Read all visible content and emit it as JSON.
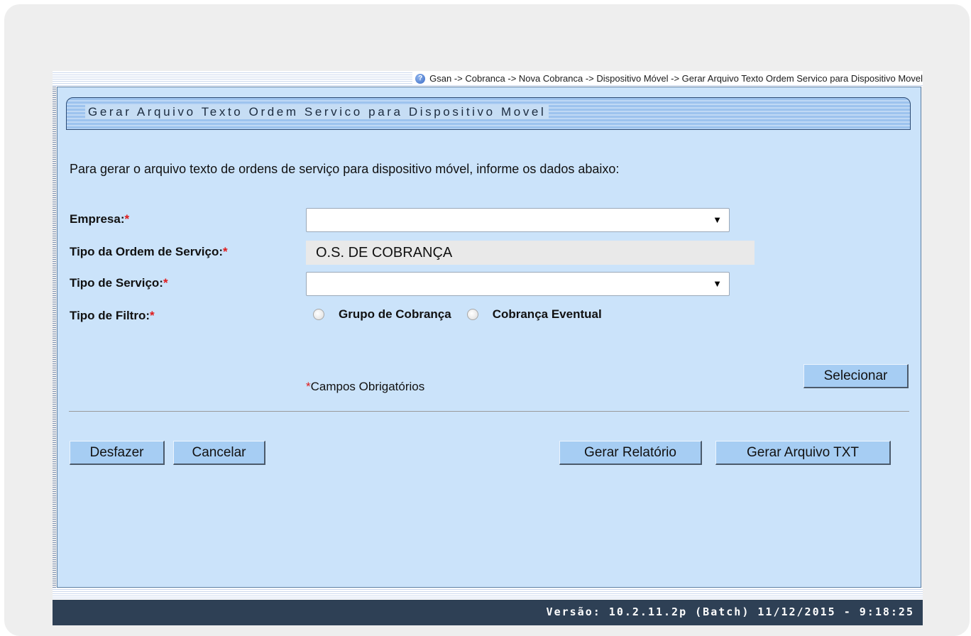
{
  "breadcrumb": "Gsan -> Cobranca -> Nova Cobranca -> Dispositivo Móvel -> Gerar Arquivo Texto Ordem Servico para Dispositivo Movel",
  "title": "Gerar Arquivo Texto Ordem Servico para Dispositivo Movel",
  "intro": "Para gerar o arquivo texto de ordens de serviço para dispositivo móvel, informe os dados abaixo:",
  "form": {
    "empresa_label": "Empresa:",
    "tipo_ordem_label": "Tipo da Ordem de Serviço:",
    "tipo_ordem_value": "O.S. DE COBRANÇA",
    "tipo_servico_label": "Tipo de Serviço:",
    "tipo_filtro_label": "Tipo de Filtro:",
    "required_mark": "*",
    "empresa_value": "",
    "tipo_servico_value": "",
    "select_arrow": "▼",
    "filter_options": [
      "Grupo de Cobrança",
      "Cobrança Eventual"
    ]
  },
  "buttons": {
    "selecionar": "Selecionar",
    "desfazer": "Desfazer",
    "cancelar": "Cancelar",
    "gerar_relatorio": "Gerar Relatório",
    "gerar_arquivo": "Gerar Arquivo TXT"
  },
  "mandatory_note": "Campos Obrigatórios",
  "footer": "Versão: 10.2.11.2p (Batch) 11/12/2015 - 9:18:25",
  "colors": {
    "panel_bg": "#cbe3fa",
    "button_bg": "#a6cdf3",
    "footer_bg": "#2e4055",
    "required": "#e01a1a"
  }
}
